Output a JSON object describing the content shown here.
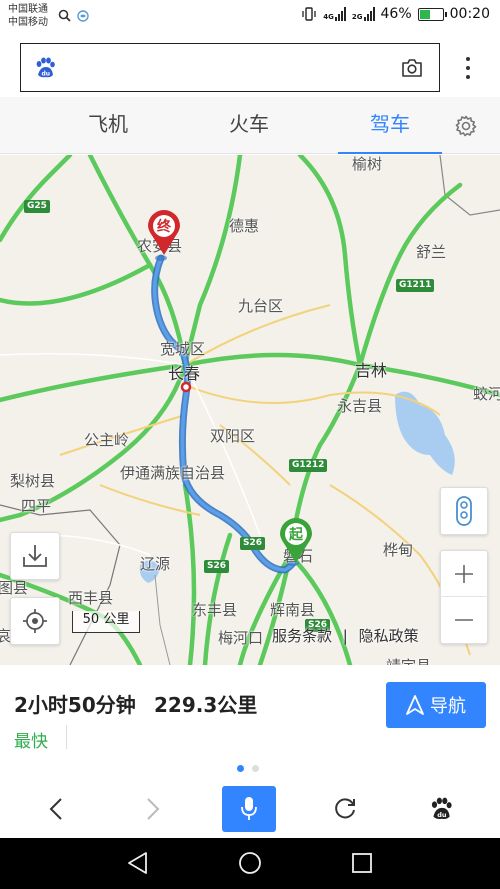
{
  "status_bar": {
    "carrier_1": "中国联通",
    "carrier_2": "中国移动",
    "network_1": "4G",
    "network_2": "2G",
    "battery": "46%",
    "time": "00:20"
  },
  "search": {
    "value": "",
    "placeholder": ""
  },
  "tabs": [
    {
      "label": "飞机",
      "active": false
    },
    {
      "label": "火车",
      "active": false
    },
    {
      "label": "驾车",
      "active": true
    }
  ],
  "map": {
    "places": [
      "榆树",
      "德惠",
      "舒兰",
      "农安县",
      "九台区",
      "宽城区",
      "长春",
      "吉林",
      "蛟河",
      "永吉县",
      "公主岭",
      "双阳区",
      "伊通满族自治县",
      "梨树县",
      "四平",
      "磐石",
      "桦甸",
      "辽源",
      "西丰县",
      "东丰县",
      "辉南县",
      "梅河口",
      "靖宇县",
      "图县",
      "哀"
    ],
    "roads": [
      "G25",
      "G1211",
      "G1212",
      "S26",
      "S26",
      "S26"
    ],
    "start_marker": "起",
    "end_marker": "终",
    "scale": "50 公里",
    "legal": {
      "service": "服务条款",
      "separator": "|",
      "privacy": "隐私政策"
    },
    "route_color": "#4a90d9",
    "highway_color": "#5cc95c"
  },
  "route": {
    "duration": "2小时50分钟",
    "distance": "229.3公里",
    "tag": "最快",
    "nav_label": "导航",
    "page_count": 2,
    "current_page": 1
  },
  "colors": {
    "accent": "#3385ff",
    "fastest": "#2fae4c",
    "start": "#3aa33a",
    "end": "#d0282c"
  }
}
